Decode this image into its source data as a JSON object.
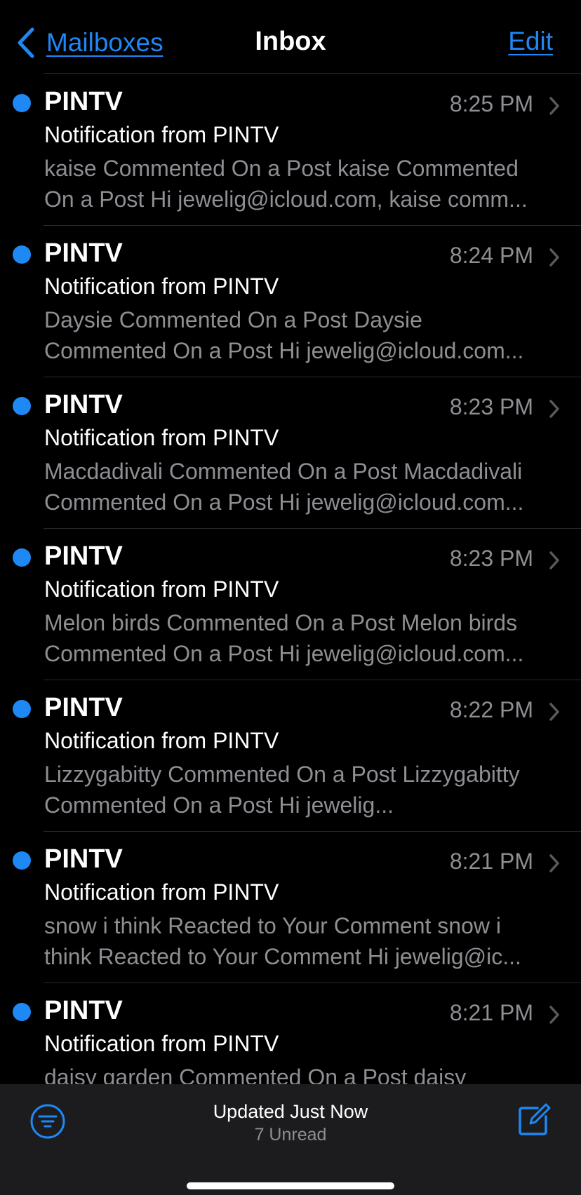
{
  "nav": {
    "back_label": "Mailboxes",
    "title": "Inbox",
    "edit_label": "Edit"
  },
  "messages": [
    {
      "sender": "PINTV",
      "time": "8:25 PM",
      "subject": "Notification from PINTV",
      "preview": "kaise Commented On a Post kaise Commented On a Post Hi jewelig@icloud.com, kaise comm...",
      "unread": true
    },
    {
      "sender": "PINTV",
      "time": "8:24 PM",
      "subject": "Notification from PINTV",
      "preview": "Daysie Commented On a Post Daysie Commented On a Post Hi jewelig@icloud.com...",
      "unread": true
    },
    {
      "sender": "PINTV",
      "time": "8:23 PM",
      "subject": "Notification from PINTV",
      "preview": "Macdadivali Commented On a Post Macdadivali Commented On a Post Hi jewelig@icloud.com...",
      "unread": true
    },
    {
      "sender": "PINTV",
      "time": "8:23 PM",
      "subject": "Notification from PINTV",
      "preview": "Melon birds Commented On a Post Melon birds Commented On a Post Hi jewelig@icloud.com...",
      "unread": true
    },
    {
      "sender": "PINTV",
      "time": "8:22 PM",
      "subject": "Notification from PINTV",
      "preview": "Lizzygabitty Commented On a Post Lizzygabitty Commented On a Post Hi jewelig...",
      "unread": true
    },
    {
      "sender": "PINTV",
      "time": "8:21 PM",
      "subject": "Notification from PINTV",
      "preview": "snow i think Reacted to Your Comment snow i think Reacted to Your Comment Hi jewelig@ic...",
      "unread": true
    },
    {
      "sender": "PINTV",
      "time": "8:21 PM",
      "subject": "Notification from PINTV",
      "preview": "daisy garden Commented On a Post daisy",
      "unread": true
    }
  ],
  "toolbar": {
    "status": "Updated Just Now",
    "unread_count": "7 Unread",
    "filter_icon": "filter-icon",
    "compose_icon": "compose-icon"
  },
  "colors": {
    "accent": "#1E88F5",
    "background": "#000000",
    "secondary_text": "#8E8E93",
    "toolbar_bg": "#1C1C1E"
  }
}
